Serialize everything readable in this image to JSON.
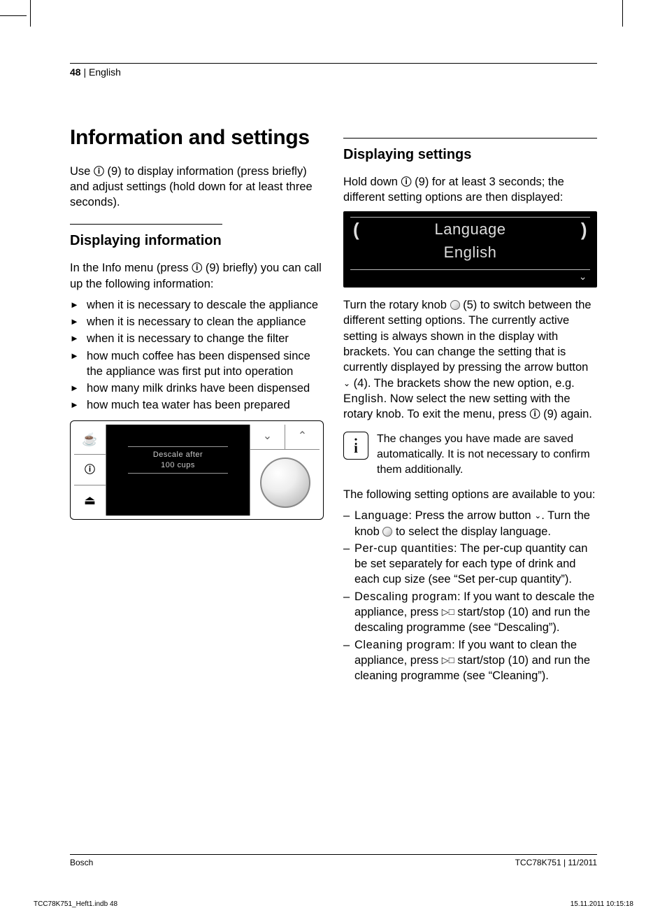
{
  "header": {
    "page_num": "48",
    "lang": "English"
  },
  "h1": "Information and settings",
  "intro": "Use ⓘ (9) to display information (press briefly) and adjust settings (hold down for at least three seconds).",
  "sec1": {
    "title": "Displaying information",
    "lead": "In the Info menu (press ⓘ (9) briefly) you can call up the following information:",
    "items": [
      "when it is necessary to descale the appliance",
      "when it is necessary to clean the appliance",
      "when it is necessary to change the filter",
      "how much coffee has been dispensed since the appliance was first put into operation",
      "how many milk drinks have been dispensed",
      "how much tea water has been prepared"
    ],
    "panel": {
      "line1": "Descale after",
      "line2": "100 cups"
    }
  },
  "sec2": {
    "title": "Displaying settings",
    "lead": "Hold down ⓘ (9) for at least 3 seconds; the different setting options are then displayed:",
    "lcd": {
      "row1": "Language",
      "row2": "English"
    },
    "para1_a": "Turn the rotary knob ",
    "para1_b": " (5) to switch between the different setting options. The currently active setting is always shown in the display with brackets. You can change the setting that is currently displayed by pressing the arrow button ",
    "para1_c": " (4). The brackets show the new option, e.g. ",
    "para1_opt": "English",
    "para1_d": ". Now select the new setting with the rotary knob. To exit the menu, press ⓘ (9) again.",
    "info_note": "The changes you have made are saved automatically. It is not necessary to confirm them additionally.",
    "opts_lead": "The following setting options are available to you:",
    "opts": [
      {
        "name": "Language",
        "text": ": Press the arrow button ⌄. Turn the knob ◯ to select the display language."
      },
      {
        "name": "Per-cup quantities",
        "text": ": The per-cup quantity can be set separately for each type of drink and each cup size (see “Set per-cup quantity”)."
      },
      {
        "name": "Descaling program",
        "text": ": If you want to descale the appliance, press ▷□ start/stop (10) and run the descaling programme (see “Descaling”)."
      },
      {
        "name": "Cleaning program",
        "text": ": If you want to clean the appliance, press ▷□ start/stop (10) and run the cleaning programme (see “Cleaning”)."
      }
    ]
  },
  "footer": {
    "left": "Bosch",
    "right": "TCC78K751 | 11/2011"
  },
  "print": {
    "left": "TCC78K751_Heft1.indb   48",
    "right": "15.11.2011   10:15:18"
  }
}
